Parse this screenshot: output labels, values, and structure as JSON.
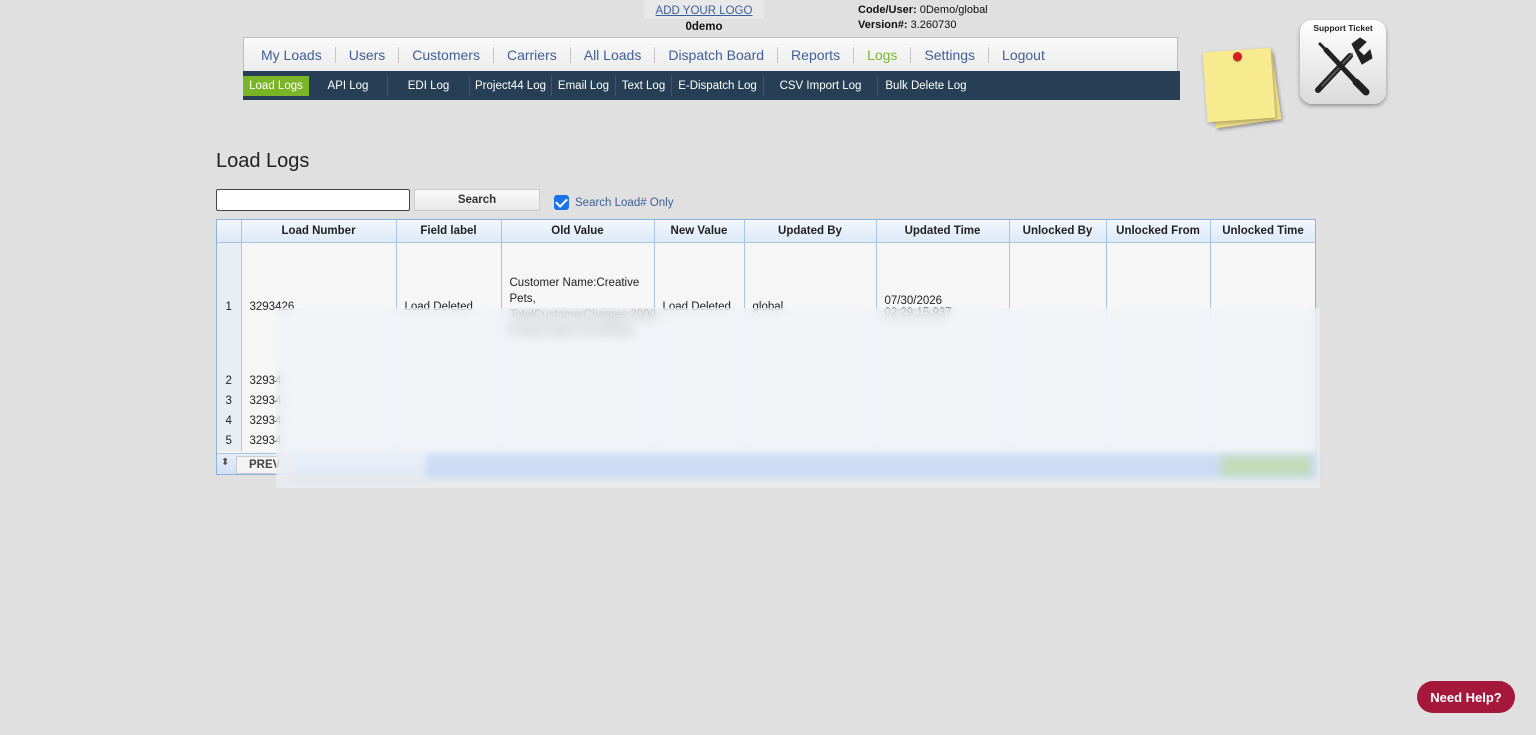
{
  "header": {
    "logo_link": "ADD YOUR LOGO",
    "company": "0demo",
    "code_user_label": "Code/User:",
    "code_user_value": "0Demo/global",
    "version_label": "Version#:",
    "version_value": "3.260730"
  },
  "main_nav": [
    "My Loads",
    "Users",
    "Customers",
    "Carriers",
    "All Loads",
    "Dispatch Board",
    "Reports",
    "Logs",
    "Settings",
    "Logout"
  ],
  "main_nav_active": "Logs",
  "sub_nav": [
    "Load Logs",
    "API Log",
    "EDI Log",
    "Project44 Log",
    "Email Log",
    "Text Log",
    "E-Dispatch Log",
    "CSV Import Log",
    "Bulk Delete Log"
  ],
  "sub_nav_active": "Load Logs",
  "support": {
    "label": "Support Ticket"
  },
  "page": {
    "title": "Load Logs"
  },
  "search": {
    "value": "",
    "button_label": "Search",
    "checkbox_label": "Search Load# Only",
    "checked": true
  },
  "table": {
    "columns": [
      "Load Number",
      "Field label",
      "Old Value",
      "New Value",
      "Updated By",
      "Updated Time",
      "Unlocked By",
      "Unlocked From",
      "Unlocked Time"
    ],
    "rows": [
      {
        "n": "1",
        "load": "3293426",
        "field": "Load Deleted",
        "old": "Customer Name:Creative Pets, TotalCustomerCharges:2000, Pickup Date:07/24/2026,",
        "new": "Load Deleted",
        "by": "global",
        "time": "07/30/2026 02:29:15.937"
      },
      {
        "n": "2",
        "load": "32934"
      },
      {
        "n": "3",
        "load": "32934"
      },
      {
        "n": "4",
        "load": "32934"
      },
      {
        "n": "5",
        "load": "32934"
      }
    ]
  },
  "pager": {
    "prev_label": "PREV"
  },
  "help": {
    "label": "Need Help?"
  },
  "colors": {
    "nav_dark": "#263f55",
    "active_green": "#7ab527",
    "help_red": "#a6183b",
    "link_blue": "#3f5f96"
  }
}
